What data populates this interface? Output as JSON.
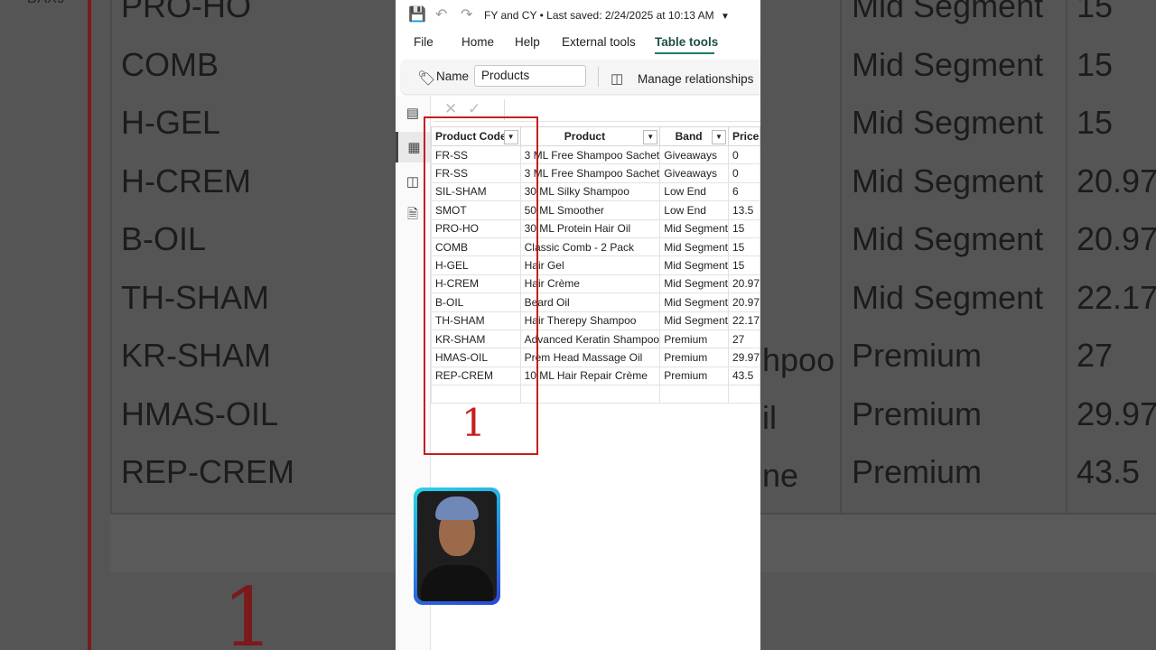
{
  "window": {
    "title": "FY and CY",
    "saved_status": "Last saved: 2/24/2025 at 10:13 AM"
  },
  "menu": {
    "items": [
      "File",
      "Home",
      "Help",
      "External tools",
      "Table tools"
    ],
    "active": "Table tools"
  },
  "ribbon": {
    "name_label": "Name",
    "name_value": "Products",
    "manage_relationships_label": "Manage relationships"
  },
  "rail": {
    "views": [
      "report-view",
      "table-view",
      "model-view",
      "dax-query-view"
    ],
    "selected": "table-view"
  },
  "table": {
    "headers": [
      "Product Code",
      "Product",
      "Band",
      "Price"
    ],
    "rows": [
      [
        "FR-SS",
        "3 ML Free Shampoo Sachet",
        "Giveaways",
        "0"
      ],
      [
        "FR-SS",
        "3 ML Free Shampoo Sachet",
        "Giveaways",
        "0"
      ],
      [
        "SIL-SHAM",
        "30 ML Silky Shampoo",
        "Low End",
        "6"
      ],
      [
        "SMOT",
        "50 ML Smoother",
        "Low End",
        "13.5"
      ],
      [
        "PRO-HO",
        "30 ML Protein Hair Oil",
        "Mid Segment",
        "15"
      ],
      [
        "COMB",
        "Classic Comb - 2 Pack",
        "Mid Segment",
        "15"
      ],
      [
        "H-GEL",
        "Hair Gel",
        "Mid Segment",
        "15"
      ],
      [
        "H-CREM",
        "Hair Crème",
        "Mid Segment",
        "20.97"
      ],
      [
        "B-OIL",
        "Beard Oil",
        "Mid Segment",
        "20.97"
      ],
      [
        "TH-SHAM",
        "Hair Therepy Shampoo",
        "Mid Segment",
        "22.17"
      ],
      [
        "KR-SHAM",
        "Advanced Keratin Shampoo",
        "Premium",
        "27"
      ],
      [
        "HMAS-OIL",
        "Prem Head Massage Oil",
        "Premium",
        "29.97"
      ],
      [
        "REP-CREM",
        "10 ML Hair Repair Crème",
        "Premium",
        "43.5"
      ]
    ]
  },
  "annotation": {
    "number": "1",
    "color": "#c41e1e"
  },
  "background": {
    "rows": [
      {
        "code": "PRO-HO",
        "band": "Mid Segment",
        "price": "15"
      },
      {
        "code": "COMB",
        "band": "Mid Segment",
        "price": "15"
      },
      {
        "code": "H-GEL",
        "band": "Mid Segment",
        "price": "15"
      },
      {
        "code": "H-CREM",
        "band": "Mid Segment",
        "price": "20.97"
      },
      {
        "code": "B-OIL",
        "band": "Mid Segment",
        "price": "20.97"
      },
      {
        "code": "TH-SHAM",
        "band": "Mid Segment",
        "price": "22.17"
      },
      {
        "code": "KR-SHAM",
        "band": "Premium",
        "price": "27"
      },
      {
        "code": "HMAS-OIL",
        "band": "Premium",
        "price": "29.97"
      },
      {
        "code": "REP-CREM",
        "band": "Premium",
        "price": "43.5"
      }
    ],
    "product_fragments": [
      "hpoo",
      "il",
      "ne"
    ],
    "corner_label": "DAX9"
  },
  "icons": {
    "save": "save-icon",
    "undo": "undo-icon",
    "redo": "redo-icon",
    "dropdown": "chevron-down-icon",
    "tag": "tag-icon",
    "relationships": "relationships-icon",
    "cancel": "close-icon",
    "commit": "check-icon"
  },
  "colors": {
    "accent": "#1f7a6c",
    "annotation": "#c41e1e",
    "webcam_border_start": "#27d4e6",
    "webcam_border_end": "#2a46d8"
  }
}
